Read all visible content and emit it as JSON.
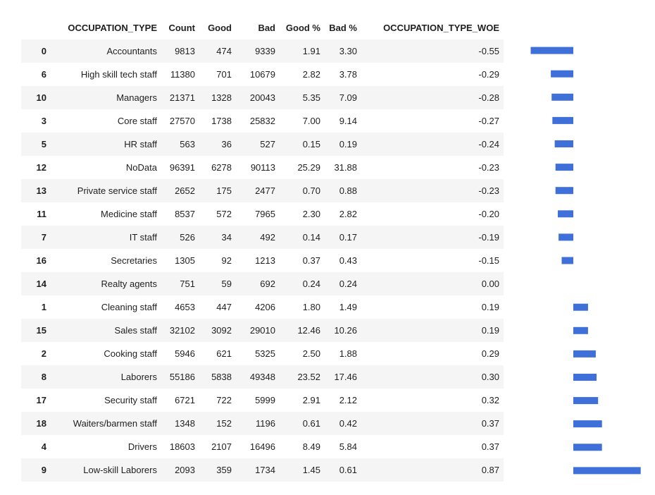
{
  "table": {
    "headers": [
      "",
      "OCCUPATION_TYPE",
      "Count",
      "Good",
      "Bad",
      "Good %",
      "Bad %",
      "OCCUPATION_TYPE_WOE"
    ],
    "rows": [
      {
        "idx": "0",
        "occ": "Accountants",
        "count": "9813",
        "good": "474",
        "bad": "9339",
        "good_pct": "1.91",
        "bad_pct": "3.30",
        "woe": "-0.55"
      },
      {
        "idx": "6",
        "occ": "High skill tech staff",
        "count": "11380",
        "good": "701",
        "bad": "10679",
        "good_pct": "2.82",
        "bad_pct": "3.78",
        "woe": "-0.29"
      },
      {
        "idx": "10",
        "occ": "Managers",
        "count": "21371",
        "good": "1328",
        "bad": "20043",
        "good_pct": "5.35",
        "bad_pct": "7.09",
        "woe": "-0.28"
      },
      {
        "idx": "3",
        "occ": "Core staff",
        "count": "27570",
        "good": "1738",
        "bad": "25832",
        "good_pct": "7.00",
        "bad_pct": "9.14",
        "woe": "-0.27"
      },
      {
        "idx": "5",
        "occ": "HR staff",
        "count": "563",
        "good": "36",
        "bad": "527",
        "good_pct": "0.15",
        "bad_pct": "0.19",
        "woe": "-0.24"
      },
      {
        "idx": "12",
        "occ": "NoData",
        "count": "96391",
        "good": "6278",
        "bad": "90113",
        "good_pct": "25.29",
        "bad_pct": "31.88",
        "woe": "-0.23"
      },
      {
        "idx": "13",
        "occ": "Private service staff",
        "count": "2652",
        "good": "175",
        "bad": "2477",
        "good_pct": "0.70",
        "bad_pct": "0.88",
        "woe": "-0.23"
      },
      {
        "idx": "11",
        "occ": "Medicine staff",
        "count": "8537",
        "good": "572",
        "bad": "7965",
        "good_pct": "2.30",
        "bad_pct": "2.82",
        "woe": "-0.20"
      },
      {
        "idx": "7",
        "occ": "IT staff",
        "count": "526",
        "good": "34",
        "bad": "492",
        "good_pct": "0.14",
        "bad_pct": "0.17",
        "woe": "-0.19"
      },
      {
        "idx": "16",
        "occ": "Secretaries",
        "count": "1305",
        "good": "92",
        "bad": "1213",
        "good_pct": "0.37",
        "bad_pct": "0.43",
        "woe": "-0.15"
      },
      {
        "idx": "14",
        "occ": "Realty agents",
        "count": "751",
        "good": "59",
        "bad": "692",
        "good_pct": "0.24",
        "bad_pct": "0.24",
        "woe": "0.00"
      },
      {
        "idx": "1",
        "occ": "Cleaning staff",
        "count": "4653",
        "good": "447",
        "bad": "4206",
        "good_pct": "1.80",
        "bad_pct": "1.49",
        "woe": "0.19"
      },
      {
        "idx": "15",
        "occ": "Sales staff",
        "count": "32102",
        "good": "3092",
        "bad": "29010",
        "good_pct": "12.46",
        "bad_pct": "10.26",
        "woe": "0.19"
      },
      {
        "idx": "2",
        "occ": "Cooking staff",
        "count": "5946",
        "good": "621",
        "bad": "5325",
        "good_pct": "2.50",
        "bad_pct": "1.88",
        "woe": "0.29"
      },
      {
        "idx": "8",
        "occ": "Laborers",
        "count": "55186",
        "good": "5838",
        "bad": "49348",
        "good_pct": "23.52",
        "bad_pct": "17.46",
        "woe": "0.30"
      },
      {
        "idx": "17",
        "occ": "Security staff",
        "count": "6721",
        "good": "722",
        "bad": "5999",
        "good_pct": "2.91",
        "bad_pct": "2.12",
        "woe": "0.32"
      },
      {
        "idx": "18",
        "occ": "Waiters/barmen staff",
        "count": "1348",
        "good": "152",
        "bad": "1196",
        "good_pct": "0.61",
        "bad_pct": "0.42",
        "woe": "0.37"
      },
      {
        "idx": "4",
        "occ": "Drivers",
        "count": "18603",
        "good": "2107",
        "bad": "16496",
        "good_pct": "8.49",
        "bad_pct": "5.84",
        "woe": "0.37"
      },
      {
        "idx": "9",
        "occ": "Low-skill Laborers",
        "count": "2093",
        "good": "359",
        "bad": "1734",
        "good_pct": "1.45",
        "bad_pct": "0.61",
        "woe": "0.87"
      }
    ]
  },
  "bar_color": "#3f6fd8",
  "woe_values": [
    -0.55,
    -0.29,
    -0.28,
    -0.27,
    -0.24,
    -0.23,
    -0.23,
    -0.2,
    -0.19,
    -0.15,
    0.0,
    0.19,
    0.19,
    0.29,
    0.3,
    0.32,
    0.37,
    0.37,
    0.87
  ]
}
